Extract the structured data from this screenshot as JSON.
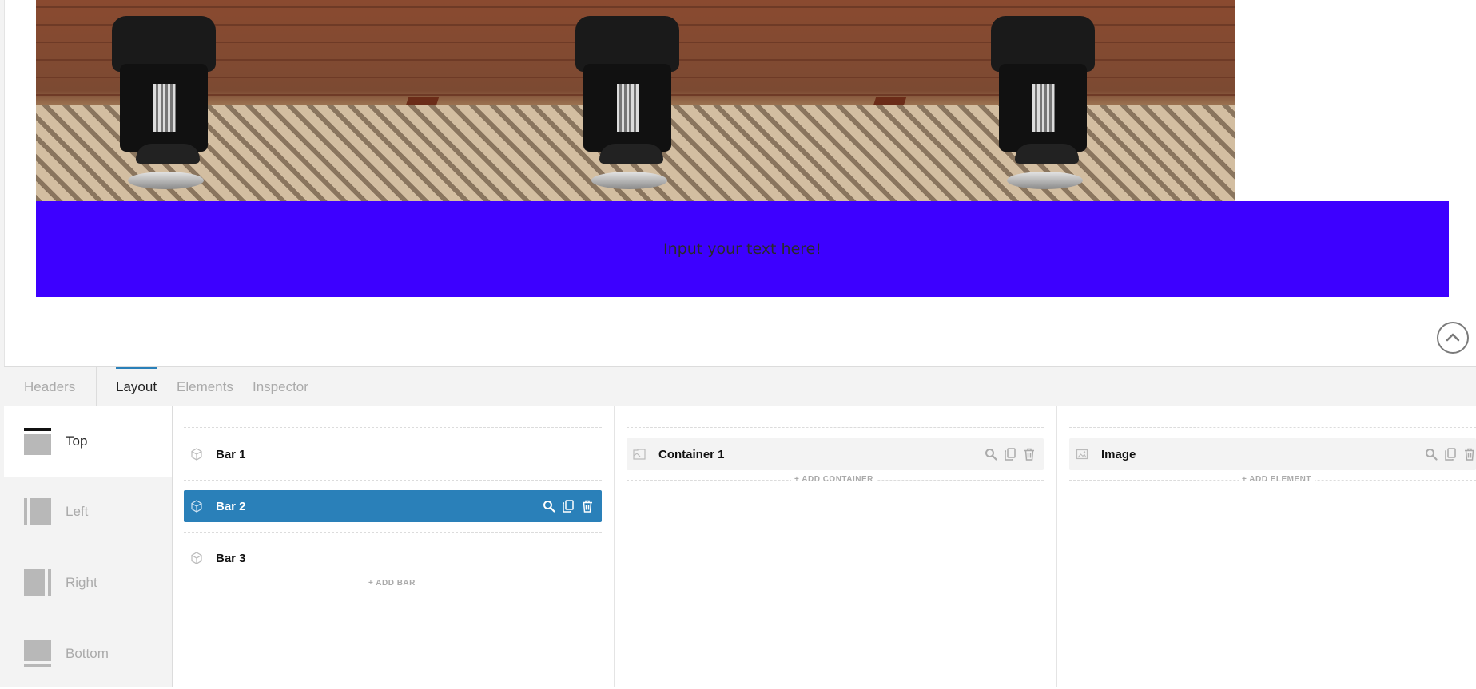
{
  "banner": {
    "text": "Input your text here!"
  },
  "tabs": [
    {
      "label": "Headers"
    },
    {
      "label": "Layout"
    },
    {
      "label": "Elements"
    },
    {
      "label": "Inspector"
    }
  ],
  "positions": [
    {
      "label": "Top"
    },
    {
      "label": "Left"
    },
    {
      "label": "Right"
    },
    {
      "label": "Bottom"
    }
  ],
  "bars": {
    "items": [
      {
        "label": "Bar 1"
      },
      {
        "label": "Bar 2"
      },
      {
        "label": "Bar 3"
      }
    ],
    "selected": "Bar 2",
    "add_label": "+ ADD BAR"
  },
  "containers": {
    "items": [
      {
        "label": "Container 1"
      }
    ],
    "add_label": "+ ADD CONTAINER"
  },
  "elements": {
    "items": [
      {
        "label": "Image"
      }
    ],
    "add_label": "+ ADD ELEMENT"
  },
  "colors": {
    "accent": "#2a80b9",
    "banner": "#3d00ff"
  }
}
